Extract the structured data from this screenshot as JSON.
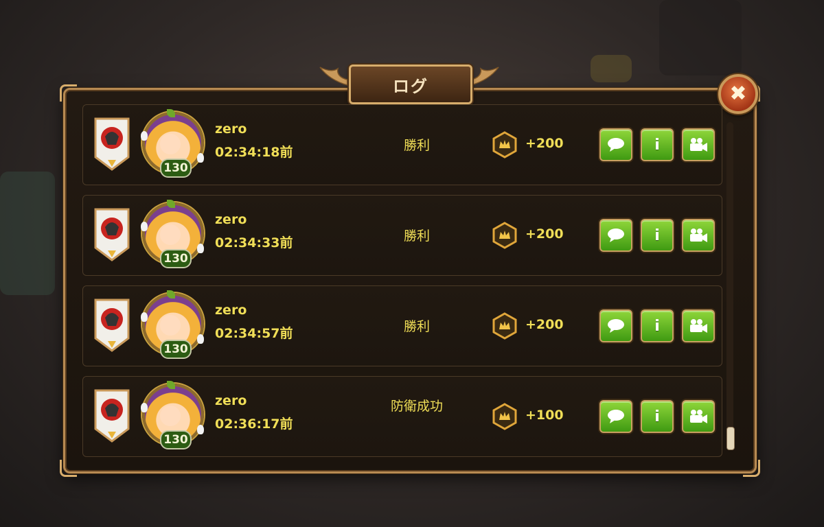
{
  "window": {
    "title": "ログ",
    "close_icon": "close-x-icon"
  },
  "colors": {
    "accent_gold": "#f0de57",
    "button_green": "#5cb81e",
    "panel_border": "#b78a52"
  },
  "rows": [
    {
      "player_name": "zero",
      "time": "02:34:18前",
      "level": "130",
      "result": "勝利",
      "points": "+200"
    },
    {
      "player_name": "zero",
      "time": "02:34:33前",
      "level": "130",
      "result": "勝利",
      "points": "+200"
    },
    {
      "player_name": "zero",
      "time": "02:34:57前",
      "level": "130",
      "result": "勝利",
      "points": "+200"
    },
    {
      "player_name": "zero",
      "time": "02:36:17前",
      "level": "130",
      "result": "防衛成功",
      "points": "+100"
    }
  ],
  "buttons": {
    "chat_icon": "chat-bubble-icon",
    "info_label": "i",
    "video_icon": "video-camera-icon"
  }
}
